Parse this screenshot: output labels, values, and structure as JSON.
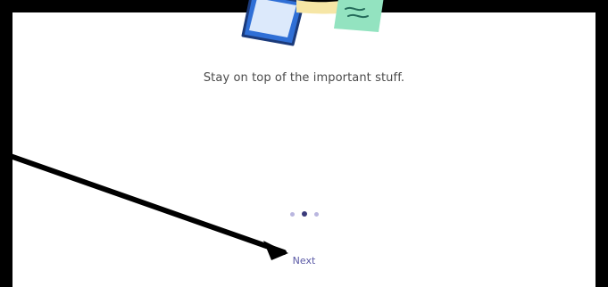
{
  "onboarding": {
    "tagline": "Stay on top of the important stuff.",
    "pager": {
      "count": 3,
      "active_index": 1
    },
    "next_label": "Next"
  },
  "colors": {
    "text": "#4a4a4a",
    "accent": "#5b5aa6",
    "dot_inactive": "#b9b6df",
    "dot_active": "#3a3a7a"
  },
  "annotation": {
    "type": "arrow",
    "color": "#000000",
    "points_to": "next-button"
  }
}
